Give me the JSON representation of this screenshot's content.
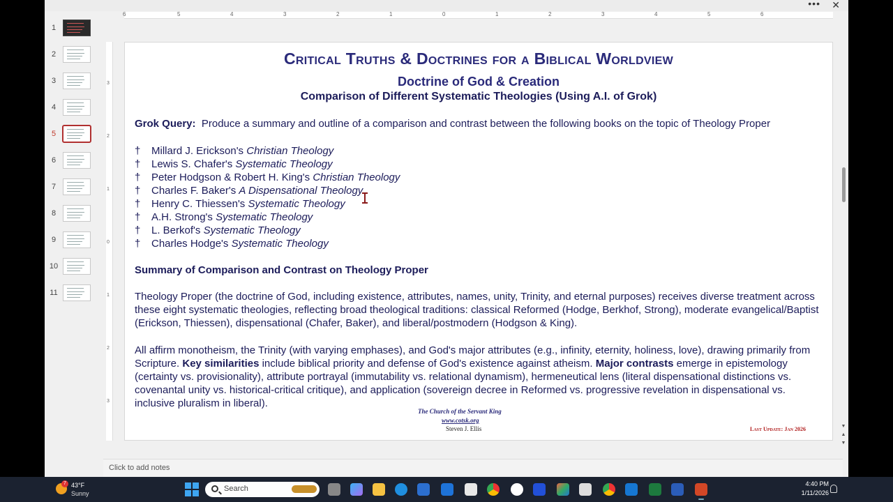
{
  "window": {
    "more_glyph": "•••",
    "close_glyph": "✕"
  },
  "thumbnails": [
    {
      "num": "1"
    },
    {
      "num": "2"
    },
    {
      "num": "3"
    },
    {
      "num": "4"
    },
    {
      "num": "5"
    },
    {
      "num": "6"
    },
    {
      "num": "7"
    },
    {
      "num": "8"
    },
    {
      "num": "9"
    },
    {
      "num": "10"
    },
    {
      "num": "11"
    }
  ],
  "active_slide": "5",
  "ruler": {
    "h_ticks": [
      "6",
      "5",
      "4",
      "3",
      "2",
      "1",
      "0",
      "1",
      "2",
      "3",
      "4",
      "5",
      "6"
    ],
    "v_ticks": [
      "3",
      "2",
      "1",
      "0",
      "1",
      "2",
      "3"
    ]
  },
  "slide": {
    "title": "Critical Truths & Doctrines for a Biblical Worldview",
    "subtitle": "Doctrine of God & Creation",
    "subtitle2": "Comparison of Different Systematic Theologies (Using A.I. of Grok)",
    "query_label": "Grok Query:",
    "query_text": "Produce a summary and outline of a comparison and contrast between the following books on the topic of Theology Proper",
    "bullet_glyph": "†",
    "books": [
      {
        "author": "Millard J. Erickson's ",
        "title": "Christian Theology"
      },
      {
        "author": "Lewis S. Chafer's ",
        "title": "Systematic Theology"
      },
      {
        "author": "Peter Hodgson & Robert H. King's ",
        "title": "Christian Theology"
      },
      {
        "author": "Charles F. Baker's ",
        "title": "A Dispensational Theology"
      },
      {
        "author": "Henry C. Thiessen's ",
        "title": "Systematic Theology"
      },
      {
        "author": "A.H. Strong's ",
        "title": "Systematic Theology"
      },
      {
        "author": "L. Berkof's ",
        "title": "Systematic Theology"
      },
      {
        "author": "Charles Hodge's ",
        "title": "Systematic Theology"
      }
    ],
    "section_heading": "Summary of Comparison and Contrast on Theology Proper",
    "para1": "Theology Proper (the doctrine of God, including existence, attributes, names, unity, Trinity, and eternal purposes) receives diverse treatment across these eight systematic theologies, reflecting broad theological traditions: classical Reformed (Hodge, Berkhof, Strong), moderate evangelical/Baptist (Erickson, Thiessen), dispensational (Chafer, Baker), and liberal/postmodern (Hodgson & King).",
    "para2_a": "All affirm monotheism, the Trinity (with varying emphases), and God's major attributes (e.g., infinity, eternity, holiness, love), drawing primarily from Scripture. ",
    "para2_b": "Key similarities",
    "para2_c": " include biblical priority and defense of God's existence against atheism. ",
    "para2_d": "Major contrasts",
    "para2_e": " emerge in epistemology (certainty vs. provisionality), attribute portrayal (immutability vs. relational dynamism), hermeneutical lens (literal dispensational distinctions vs. covenantal unity vs. historical-critical critique), and application (sovereign decree in Reformed vs. progressive revelation in dispensational vs. inclusive pluralism in liberal).",
    "footer_org": "The Church of the Servant King",
    "footer_url": "www.cotsk.org",
    "footer_name": "Steven J. Ellis",
    "footer_update": "Last Update: Jan 2026"
  },
  "notes_placeholder": "Click to add notes",
  "taskbar": {
    "weather_temp": "43°F",
    "weather_cond": "Sunny",
    "weather_badge": "7",
    "search_placeholder": "Search",
    "time": "4:40 PM",
    "date": "1/11/2026",
    "colors": {
      "bg": "#1b2230",
      "accent": "#3ea6f2"
    }
  }
}
